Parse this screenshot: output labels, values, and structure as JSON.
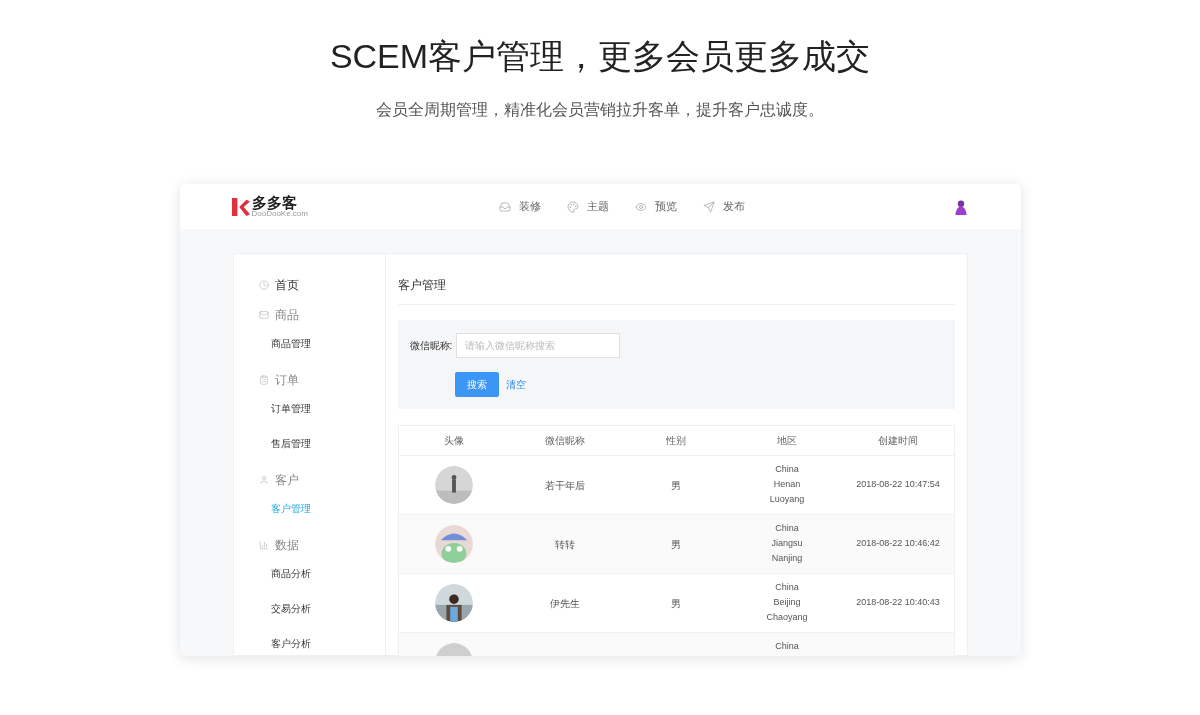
{
  "headline": "SCEM客户管理，更多会员更多成交",
  "subtitle": "会员全周期管理，精准化会员营销拉升客单，提升客户忠诚度。",
  "app": {
    "logo": {
      "name": "多多客",
      "domain": "DooDooKe.com"
    },
    "nav": [
      {
        "label": "装修"
      },
      {
        "label": "主题"
      },
      {
        "label": "预览"
      },
      {
        "label": "发布"
      }
    ],
    "sidebar": [
      {
        "label": "首页"
      },
      {
        "label": "商品",
        "children": [
          {
            "label": "商品管理",
            "selected": false
          }
        ]
      },
      {
        "label": "订单",
        "children": [
          {
            "label": "订单管理",
            "selected": false
          },
          {
            "label": "售后管理",
            "selected": false
          }
        ]
      },
      {
        "label": "客户",
        "children": [
          {
            "label": "客户管理",
            "selected": true
          }
        ]
      },
      {
        "label": "数据",
        "children": [
          {
            "label": "商品分析",
            "selected": false
          },
          {
            "label": "交易分析",
            "selected": false
          },
          {
            "label": "客户分析",
            "selected": false
          }
        ]
      }
    ],
    "page_title": "客户管理",
    "filter": {
      "label": "微信昵称:",
      "placeholder": "请输入微信昵称搜索",
      "search_button": "搜索",
      "clear_link": "清空"
    },
    "table": {
      "columns": [
        "头像",
        "微信昵称",
        "性别",
        "地区",
        "创建时间"
      ],
      "rows": [
        {
          "nickname": "若干年后",
          "gender": "男",
          "region": [
            "China",
            "Henan",
            "Luoyang"
          ],
          "created": "2018-08-22 10:47:54"
        },
        {
          "nickname": "转转",
          "gender": "男",
          "region": [
            "China",
            "Jiangsu",
            "Nanjing"
          ],
          "created": "2018-08-22 10:46:42"
        },
        {
          "nickname": "伊先生",
          "gender": "男",
          "region": [
            "China",
            "Beijing",
            "Chaoyang"
          ],
          "created": "2018-08-22 10:40:43"
        },
        {
          "region": [
            "China"
          ]
        }
      ]
    }
  }
}
